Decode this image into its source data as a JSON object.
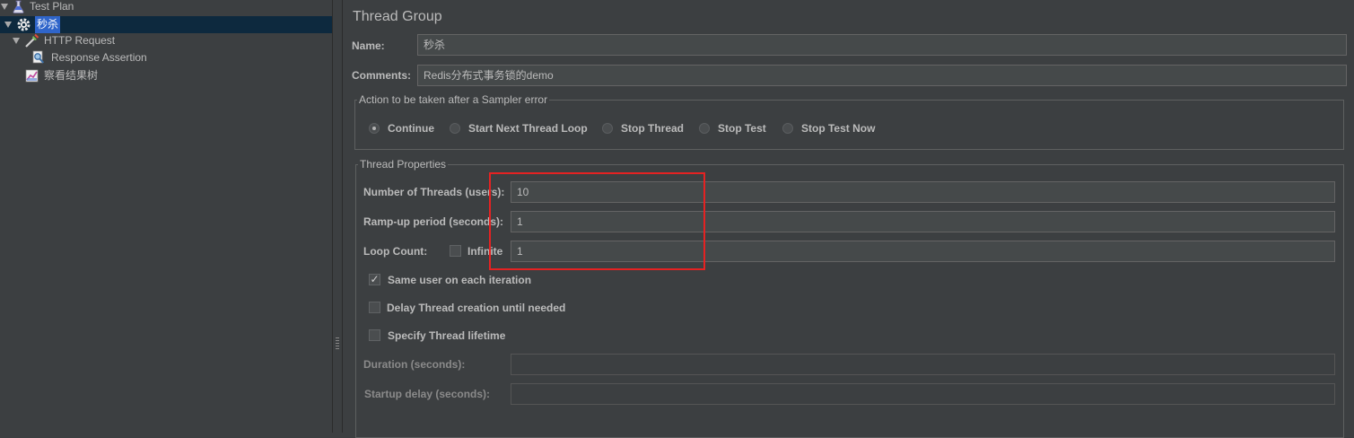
{
  "tree": {
    "test_plan": "Test Plan",
    "thread_group": "秒杀",
    "http_request": "HTTP Request",
    "response_assertion": "Response Assertion",
    "view_results_tree": "察看结果树"
  },
  "panel": {
    "title": "Thread Group",
    "name_label": "Name:",
    "name_value": "秒杀",
    "comments_label": "Comments:",
    "comments_value": "Redis分布式事务锁的demo"
  },
  "sampler_error": {
    "legend": "Action to be taken after a Sampler error",
    "options": [
      "Continue",
      "Start Next Thread Loop",
      "Stop Thread",
      "Stop Test",
      "Stop Test Now"
    ],
    "selected": "Continue"
  },
  "thread_properties": {
    "legend": "Thread Properties",
    "num_threads_label": "Number of Threads (users):",
    "num_threads": "10",
    "ramp_up_label": "Ramp-up period (seconds):",
    "ramp_up": "1",
    "loop_count_label": "Loop Count:",
    "infinite_label": "Infinite",
    "infinite_checked": false,
    "loop_count": "1",
    "same_user_label": "Same user on each iteration",
    "same_user_checked": true,
    "delay_label": "Delay Thread creation until needed",
    "delay_checked": false,
    "lifetime_label": "Specify Thread lifetime",
    "lifetime_checked": false,
    "duration_label": "Duration (seconds):",
    "duration": "",
    "startup_delay_label": "Startup delay (seconds):",
    "startup_delay": ""
  },
  "colors": {
    "background": "#3c3f41",
    "selection": "#2f65ca",
    "highlight_box": "#e52222"
  }
}
